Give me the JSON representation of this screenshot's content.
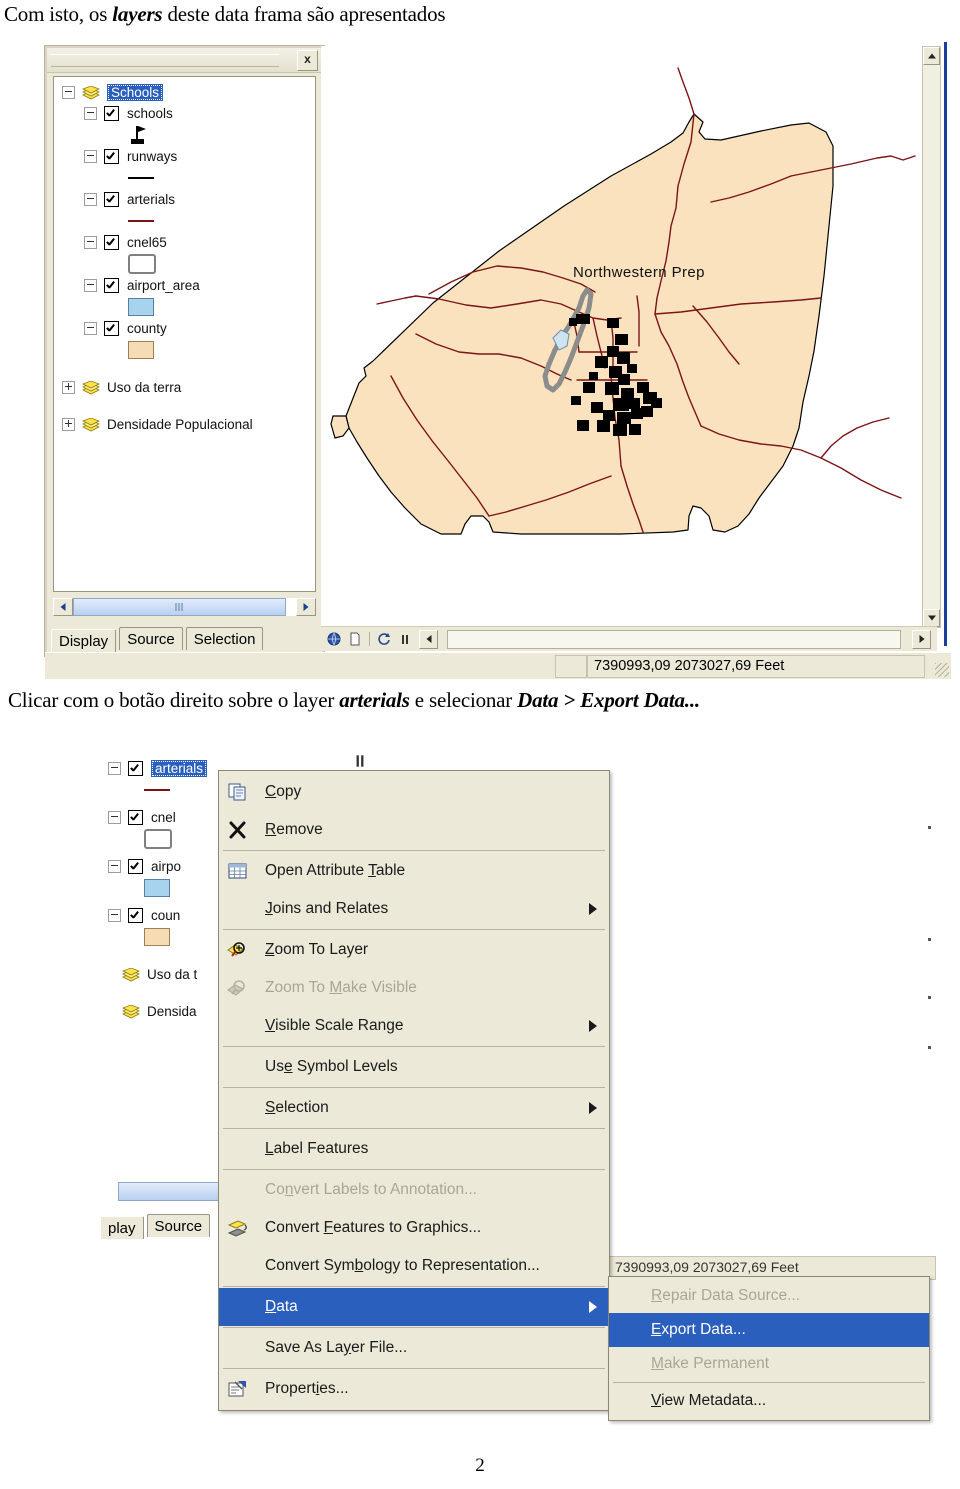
{
  "document": {
    "paragraph_1_prefix": "Com isto, os ",
    "paragraph_1_bold": "layers",
    "paragraph_1_suffix": " deste data frama são apresentados",
    "paragraph_2_prefix": "Clicar com o botão direito sobre o layer ",
    "paragraph_2_bold1": "arterials",
    "paragraph_2_mid": " e selecionar ",
    "paragraph_2_bold2": "Data > Export Data...",
    "page_number": "2"
  },
  "arcmap": {
    "toc": {
      "close_label": "x",
      "group": {
        "label": "Schools",
        "icon": "layers-icon",
        "selected": true
      },
      "layers": [
        {
          "label": "schools",
          "checked": true,
          "symbol": "flag"
        },
        {
          "label": "runways",
          "checked": true,
          "symbol": "line-black"
        },
        {
          "label": "arterials",
          "checked": true,
          "symbol": "line-dark-red"
        },
        {
          "label": "cnel65",
          "checked": true,
          "symbol": "box-outline"
        },
        {
          "label": "airport_area",
          "checked": true,
          "symbol": "fill-blue"
        },
        {
          "label": "county",
          "checked": true,
          "symbol": "fill-tan"
        }
      ],
      "collapsed_groups": [
        {
          "label": "Uso da terra"
        },
        {
          "label": "Densidade Populacional"
        }
      ],
      "tabs": [
        {
          "label": "Display",
          "active": true
        },
        {
          "label": "Source",
          "active": false
        },
        {
          "label": "Selection",
          "active": false
        }
      ]
    },
    "map": {
      "label": "Northwestern Prep",
      "county_fill": "#f9e2bd",
      "county_outline": "#000000",
      "road_color": "#7d1414",
      "airport_outline": "#8c8c8c",
      "airport_fill": "#cfe4f2"
    },
    "status_bar": {
      "coordinates": "7390993,09  2073027,69 Feet"
    }
  },
  "context_menu": {
    "items": [
      {
        "label": "Copy",
        "underline": "C",
        "icon": "copy-icon",
        "disabled": false,
        "submenu": false,
        "highlight": false
      },
      {
        "label": "Remove",
        "underline": "R",
        "icon": "remove-icon",
        "disabled": false,
        "submenu": false,
        "highlight": false
      },
      {
        "separator": true
      },
      {
        "label": "Open Attribute Table",
        "underline": "T",
        "icon": "table-icon",
        "disabled": false,
        "submenu": false,
        "highlight": false
      },
      {
        "label": "Joins and Relates",
        "underline": "J",
        "icon": null,
        "disabled": false,
        "submenu": true,
        "highlight": false
      },
      {
        "separator": true
      },
      {
        "label": "Zoom To Layer",
        "underline": "Z",
        "icon": "zoom-layer-icon",
        "disabled": false,
        "submenu": false,
        "highlight": false
      },
      {
        "label": "Zoom To Make Visible",
        "underline": "M",
        "icon": "zoom-visible-icon",
        "disabled": true,
        "submenu": false,
        "highlight": false
      },
      {
        "label": "Visible Scale Range",
        "underline": "V",
        "icon": null,
        "disabled": false,
        "submenu": true,
        "highlight": false
      },
      {
        "separator": true
      },
      {
        "label": "Use Symbol Levels",
        "underline": "e",
        "icon": null,
        "disabled": false,
        "submenu": false,
        "highlight": false
      },
      {
        "separator": true
      },
      {
        "label": "Selection",
        "underline": "S",
        "icon": null,
        "disabled": false,
        "submenu": true,
        "highlight": false
      },
      {
        "separator": true
      },
      {
        "label": "Label Features",
        "underline": "L",
        "icon": null,
        "disabled": false,
        "submenu": false,
        "highlight": false
      },
      {
        "separator": true
      },
      {
        "label": "Convert Labels to Annotation...",
        "underline": "n",
        "icon": null,
        "disabled": true,
        "submenu": false,
        "highlight": false
      },
      {
        "label": "Convert Features to Graphics...",
        "underline": "F",
        "icon": "convert-graphics-icon",
        "disabled": false,
        "submenu": false,
        "highlight": false
      },
      {
        "label": "Convert Symbology to Representation...",
        "underline": "b",
        "icon": null,
        "disabled": false,
        "submenu": false,
        "highlight": false
      },
      {
        "separator": true
      },
      {
        "label": "Data",
        "underline": "D",
        "icon": null,
        "disabled": false,
        "submenu": true,
        "highlight": true
      },
      {
        "separator": true
      },
      {
        "label": "Save As Layer File...",
        "underline": "y",
        "icon": null,
        "disabled": false,
        "submenu": false,
        "highlight": false
      },
      {
        "separator": true
      },
      {
        "label": "Properties...",
        "underline": "i",
        "icon": "properties-icon",
        "disabled": false,
        "submenu": false,
        "highlight": false
      }
    ]
  },
  "data_submenu": {
    "items": [
      {
        "label": "Repair Data Source...",
        "underline": "R",
        "disabled": true,
        "highlight": false
      },
      {
        "label": "Export Data...",
        "underline": "E",
        "disabled": false,
        "highlight": true
      },
      {
        "label": "Make Permanent",
        "underline": "M",
        "disabled": true,
        "highlight": false
      },
      {
        "separator": true
      },
      {
        "label": "View Metadata...",
        "underline": "V",
        "disabled": false,
        "highlight": false
      }
    ]
  },
  "shot2_toc": {
    "layers": [
      {
        "label": "arterials",
        "checked": true,
        "selected": true,
        "symbol": "line-dark-red"
      },
      {
        "label": "cnel",
        "checked": true,
        "selected": false,
        "symbol": "box-outline"
      },
      {
        "label": "airpo",
        "checked": true,
        "selected": false,
        "symbol": "fill-blue"
      },
      {
        "label": "coun",
        "checked": true,
        "selected": false,
        "symbol": "fill-tan"
      }
    ],
    "groups": [
      {
        "label": "Uso da t"
      },
      {
        "label": "Densida"
      }
    ],
    "tabs": [
      {
        "label": "play",
        "active": true
      },
      {
        "label": "Source",
        "active": false
      }
    ]
  }
}
